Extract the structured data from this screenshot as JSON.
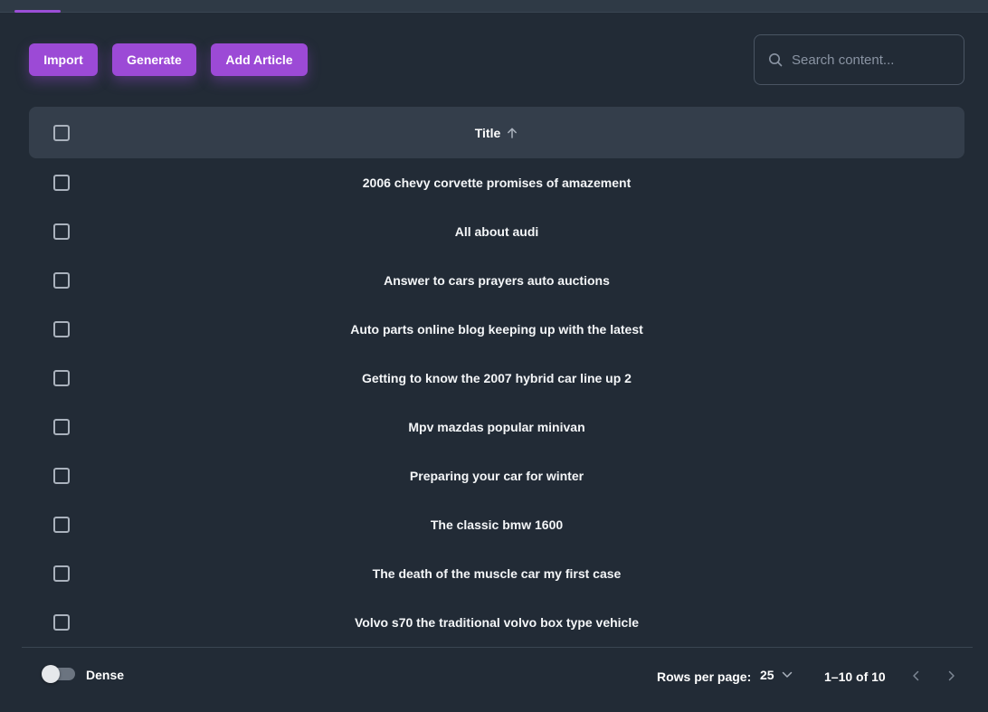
{
  "toolbar": {
    "import_label": "Import",
    "generate_label": "Generate",
    "add_article_label": "Add Article"
  },
  "search": {
    "placeholder": "Search content...",
    "icon": "search-icon"
  },
  "table": {
    "header": {
      "title": "Title",
      "sort_icon": "arrow-up-icon"
    },
    "rows": [
      {
        "title": "2006 chevy corvette promises of amazement"
      },
      {
        "title": "All about audi"
      },
      {
        "title": "Answer to cars prayers auto auctions"
      },
      {
        "title": "Auto parts online blog keeping up with the latest"
      },
      {
        "title": "Getting to know the 2007 hybrid car line up 2"
      },
      {
        "title": "Mpv mazdas popular minivan"
      },
      {
        "title": "Preparing your car for winter"
      },
      {
        "title": "The classic bmw 1600"
      },
      {
        "title": "The death of the muscle car my first case"
      },
      {
        "title": "Volvo s70 the traditional volvo box type vehicle"
      }
    ]
  },
  "footer": {
    "dense_label": "Dense",
    "dense_enabled": false,
    "rows_per_page_label": "Rows per page:",
    "rows_per_page_value": "25",
    "range_text": "1–10 of 10"
  },
  "colors": {
    "accent": "#9c4ad6",
    "background": "#222b36",
    "header_bg": "#343e4b"
  }
}
